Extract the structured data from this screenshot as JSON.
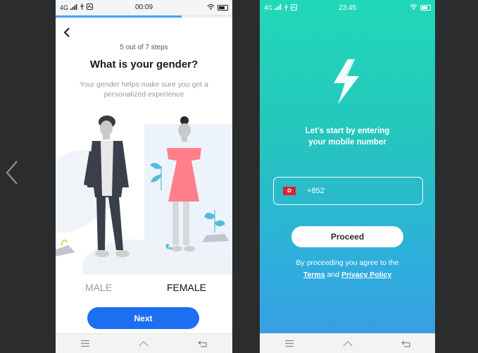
{
  "colors": {
    "page_bg": "#2b2c2e",
    "primary_button": "#1e6ef2",
    "progress": "#4a9eff",
    "teal_gradient_top": "#21d8b9",
    "teal_gradient_bottom": "#3b9ae6",
    "flag_red": "#e0202e"
  },
  "left_edge": {
    "icon": "chevron-left-icon"
  },
  "gender_screen": {
    "status_bar": {
      "network": "4G",
      "time": "00:09",
      "icons": [
        "signal-icon",
        "usb-icon",
        "notification-icon",
        "wifi-icon",
        "battery-icon"
      ]
    },
    "progress": {
      "current": 5,
      "total": 7
    },
    "back_icon": "chevron-left-icon",
    "step_text": "5 out of 7 steps",
    "title": "What is your gender?",
    "subtitle": "Your gender helps make sure you get a personalized experience",
    "options": {
      "male": "MALE",
      "female": "FEMALE"
    },
    "next_button": "Next",
    "nav": [
      "menu-icon",
      "home-icon",
      "back-icon"
    ]
  },
  "phone_screen": {
    "status_bar": {
      "network": "4G",
      "time": "23:45",
      "icons": [
        "signal-icon",
        "usb-icon",
        "notification-icon",
        "wifi-icon",
        "battery-icon"
      ]
    },
    "logo_icon": "lightning-bolt-icon",
    "lead_line1": "Let's start by entering",
    "lead_line2": "your mobile number",
    "flag_icon": "hong-kong-flag-icon",
    "dial_code": "+852",
    "proceed_button": "Proceed",
    "legal_prefix": "By proceeding you agree to the",
    "terms_link": "Terms",
    "legal_and": "and",
    "privacy_link": "Privacy Policy",
    "nav": [
      "menu-icon",
      "home-icon",
      "back-icon"
    ]
  }
}
